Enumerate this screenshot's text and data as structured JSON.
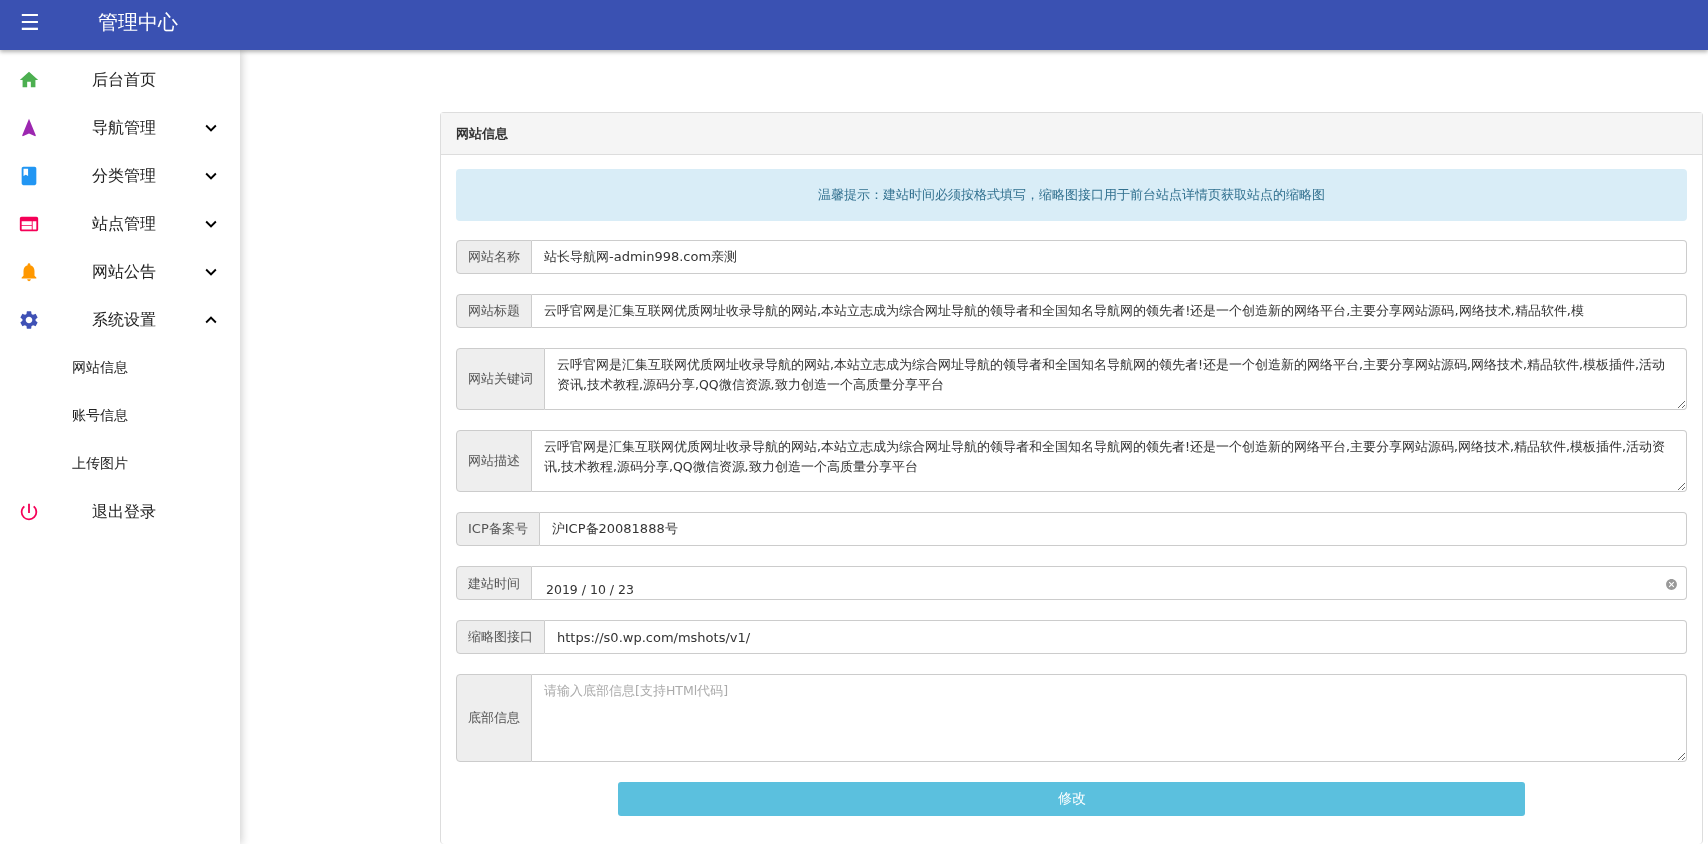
{
  "header": {
    "menu_icon": "☰",
    "title": "管理中心"
  },
  "sidebar": {
    "items": [
      {
        "label": "后台首页",
        "kind": "link",
        "color": "#4caf50"
      },
      {
        "label": "导航管理",
        "kind": "group",
        "color": "#9c27b0",
        "expanded": false
      },
      {
        "label": "分类管理",
        "kind": "group",
        "color": "#2196f3",
        "expanded": false
      },
      {
        "label": "站点管理",
        "kind": "group",
        "color": "#f50057",
        "expanded": false
      },
      {
        "label": "网站公告",
        "kind": "group",
        "color": "#ff9800",
        "expanded": false
      },
      {
        "label": "系统设置",
        "kind": "group",
        "color": "#3f51b5",
        "expanded": true,
        "children": [
          {
            "label": "网站信息"
          },
          {
            "label": "账号信息"
          },
          {
            "label": "上传图片"
          }
        ]
      },
      {
        "label": "退出登录",
        "kind": "link",
        "color": "#f50057"
      }
    ]
  },
  "panel": {
    "title": "网站信息",
    "alert": "温馨提示：建站时间必须按格式填写，缩略图接口用于前台站点详情页获取站点的缩略图",
    "fields": [
      {
        "kind": "input",
        "label": "网站名称",
        "value": "站长导航网-admin998.com亲测"
      },
      {
        "kind": "input",
        "label": "网站标题",
        "value": "云呼官网是汇集互联网优质网址收录导航的网站,本站立志成为综合网址导航的领导者和全国知名导航网的领先者!还是一个创造新的网络平台,主要分享网站源码,网络技术,精品软件,模"
      },
      {
        "kind": "textarea",
        "label": "网站关键词",
        "value": "云呼官网是汇集互联网优质网址收录导航的网站,本站立志成为综合网址导航的领导者和全国知名导航网的领先者!还是一个创造新的网络平台,主要分享网站源码,网络技术,精品软件,模板插件,活动资讯,技术教程,源码分享,QQ微信资源,致力创造一个高质量分享平台"
      },
      {
        "kind": "textarea",
        "label": "网站描述",
        "value": "云呼官网是汇集互联网优质网址收录导航的网站,本站立志成为综合网址导航的领导者和全国知名导航网的领先者!还是一个创造新的网络平台,主要分享网站源码,网络技术,精品软件,模板插件,活动资讯,技术教程,源码分享,QQ微信资源,致力创造一个高质量分享平台"
      },
      {
        "kind": "input",
        "label": "ICP备案号",
        "value": "沪ICP备20081888号"
      },
      {
        "kind": "date",
        "label": "建站时间",
        "value": "2019 / 10 / 23"
      },
      {
        "kind": "input",
        "label": "缩略图接口",
        "value": "https://s0.wp.com/mshots/v1/"
      },
      {
        "kind": "textarea",
        "label": "底部信息",
        "placeholder": "请输入底部信息[支持HTMl代码]"
      }
    ],
    "submit": "修改"
  }
}
